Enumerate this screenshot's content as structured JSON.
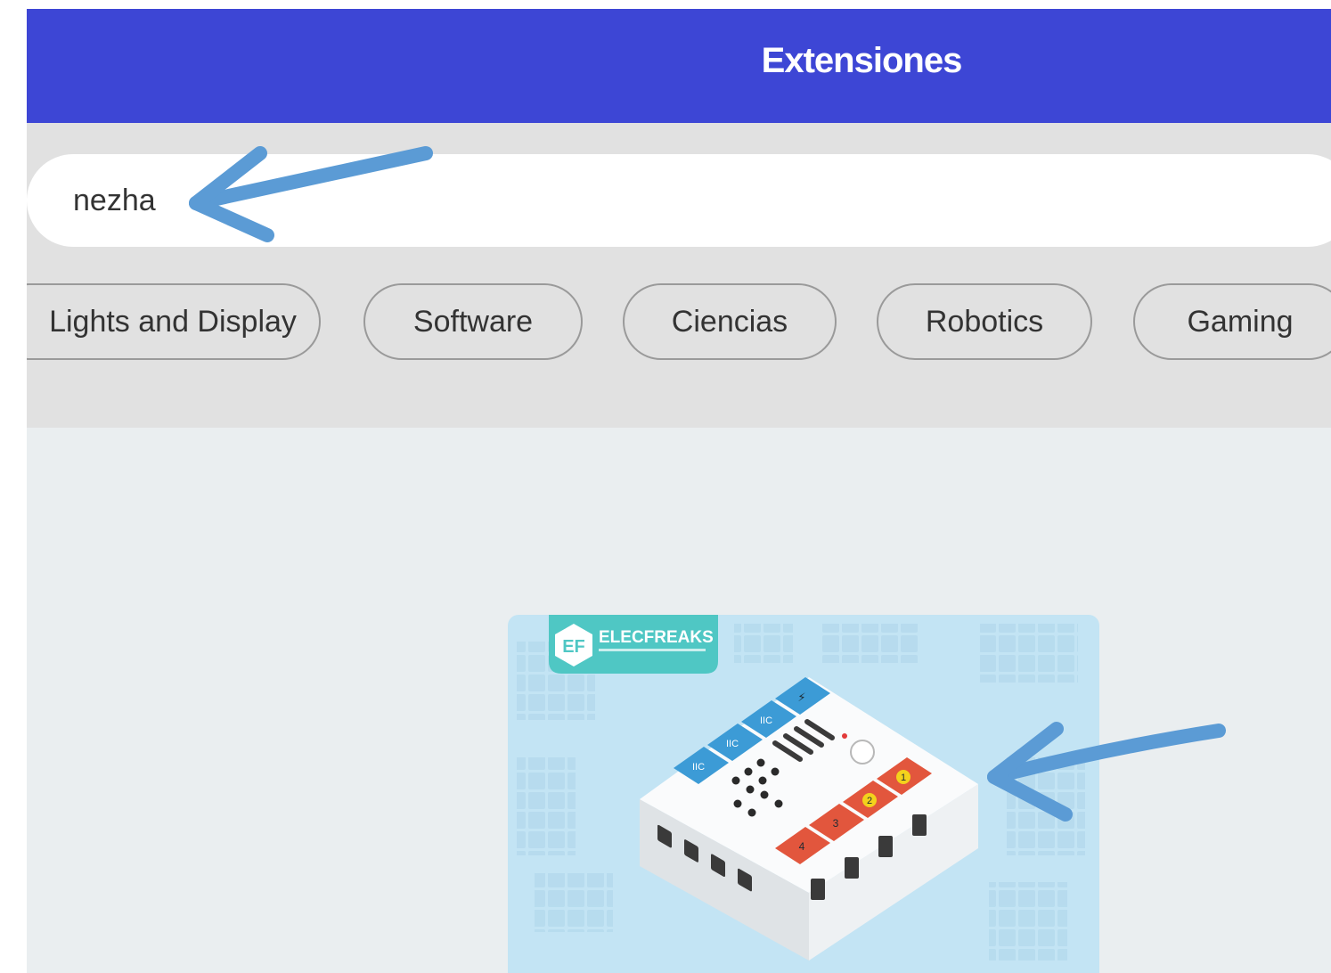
{
  "header": {
    "title": "Extensiones"
  },
  "search": {
    "value": "nezha"
  },
  "categories": [
    {
      "label": "Lights and Display"
    },
    {
      "label": "Software"
    },
    {
      "label": "Ciencias"
    },
    {
      "label": "Robotics"
    },
    {
      "label": "Gaming"
    }
  ],
  "extension_card": {
    "image_brand_text": "ELECFREAKS",
    "image_port_labels": [
      "IIC",
      "IIC",
      "IIC",
      "1",
      "2",
      "3",
      "4"
    ],
    "image_name": "nezha-board-image"
  },
  "annotations": {
    "arrow_color": "#5b9bd5",
    "arrows": [
      "search-arrow-annotation",
      "card-arrow-annotation"
    ]
  },
  "colors": {
    "header_bg": "#3d46d5",
    "filter_bg": "#e1e1e1",
    "content_bg": "#eaeef0",
    "card_bg": "#c3e4f4",
    "port_blue": "#3c9bd6",
    "port_red": "#e2563d",
    "brand_teal": "#4fc7c4"
  }
}
